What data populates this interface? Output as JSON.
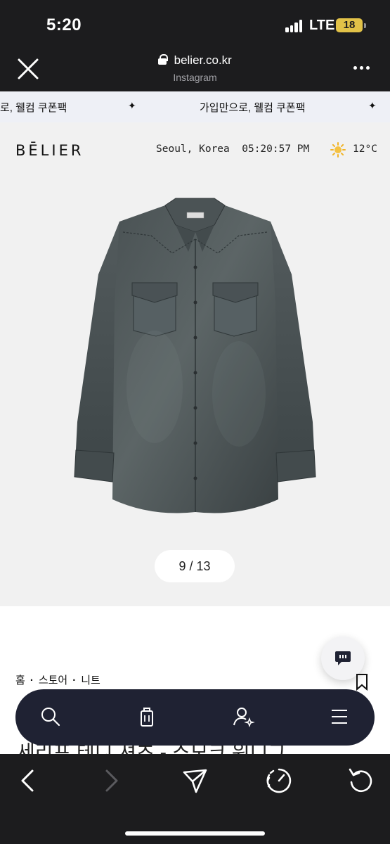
{
  "status_bar": {
    "time": "5:20",
    "network": "LTE",
    "battery": "18"
  },
  "browser": {
    "domain": "belier.co.kr",
    "source": "Instagram"
  },
  "promo": {
    "fragment_left": "로, 웰컴 쿠폰팩",
    "message": "가입만으로, 웰컴 쿠폰팩",
    "separator": "✦"
  },
  "site": {
    "logo": "BĒLIER",
    "location": "Seoul, Korea",
    "clock": "05:20:57 PM",
    "temperature": "12°C"
  },
  "gallery": {
    "pager": "9 / 13"
  },
  "breadcrumb": {
    "home": "홈",
    "store": "스토어",
    "category": "니트",
    "separator": "·"
  },
  "product": {
    "title_partial": "세리프 테니 셔츠 - 스모크 워디그"
  },
  "icons": {
    "bottom_nav": [
      "search-icon",
      "bag-icon",
      "account-icon",
      "menu-icon"
    ],
    "toolbar": [
      "back-icon",
      "forward-icon",
      "share-icon",
      "speed-icon",
      "reload-icon"
    ]
  },
  "colors": {
    "status_bg": "#1c1c1e",
    "promo_bg": "#eef0f6",
    "page_bg": "#f1f1f1",
    "nav_bg": "#1f2233",
    "battery": "#e2c248"
  }
}
